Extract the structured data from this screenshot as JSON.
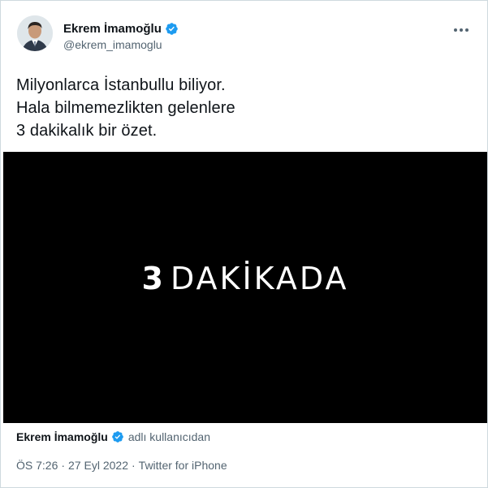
{
  "author": {
    "display_name": "Ekrem İmamoğlu",
    "handle": "@ekrem_imamoglu",
    "verified": true
  },
  "tweet": {
    "lines": [
      "Milyonlarca İstanbullu biliyor.",
      "Hala bilmemezlikten gelenlere",
      "3 dakikalık bir özet."
    ]
  },
  "media": {
    "title_number": "3",
    "title_word": "DAKİKADA"
  },
  "attribution": {
    "name": "Ekrem İmamoğlu",
    "suffix": "adlı kullanıcıdan"
  },
  "meta": {
    "time": "ÖS 7:26",
    "separator": "·",
    "date": "27 Eyl 2022",
    "source": "Twitter for iPhone"
  },
  "colors": {
    "verified_badge": "#1d9bf0",
    "text_primary": "#0f1419",
    "text_secondary": "#536471",
    "media_background": "#000000"
  },
  "icons": {
    "verified": "verified-badge-icon",
    "more": "more-horizontal-icon"
  }
}
